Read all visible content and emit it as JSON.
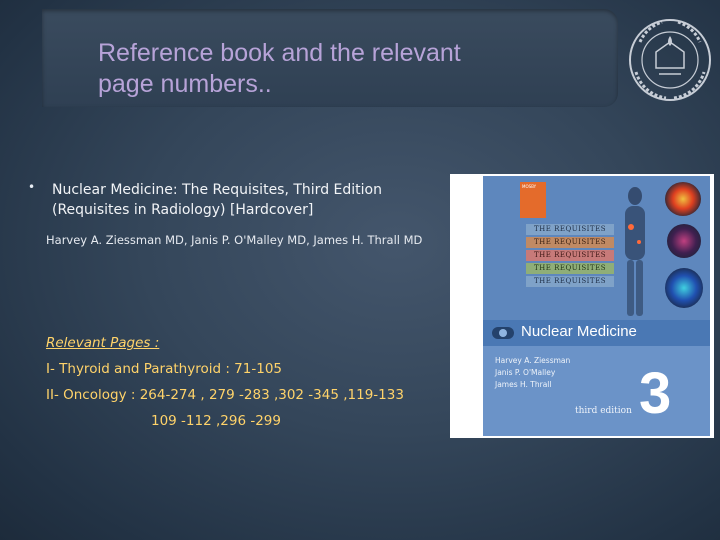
{
  "slide": {
    "title_line1": "Reference book and the relevant",
    "title_line2": "page numbers..",
    "bullet": "•",
    "reference_line1": "Nuclear Medicine: The Requisites, Third Edition",
    "reference_line2": "(Requisites in Radiology) [Hardcover]",
    "authors": "Harvey A. Ziessman MD, Janis P. O'Malley MD, James H. Thrall MD",
    "pages_heading": "Relevant Pages :",
    "pages_line1": "I- Thyroid and Parathyroid : 71-105",
    "pages_line2": "II- Oncology : 264-274 , 279 -283 ,302 -345 ,119-133",
    "pages_line3": "109 -112 ,296 -299"
  },
  "cover": {
    "publisher": "MOSBY",
    "requisites_label": "THE REQUISITES",
    "title": "Nuclear Medicine",
    "author1": "Harvey A. Ziessman",
    "author2": "Janis P. O'Malley",
    "author3": "James H. Thrall",
    "edition": "third edition",
    "edition_number": "3",
    "strip_colors": [
      "#7fa2c8",
      "#c08a64",
      "#c77a79",
      "#8fae78",
      "#7fa2c8"
    ]
  },
  "logo": {
    "icon": "university-seal-icon"
  }
}
